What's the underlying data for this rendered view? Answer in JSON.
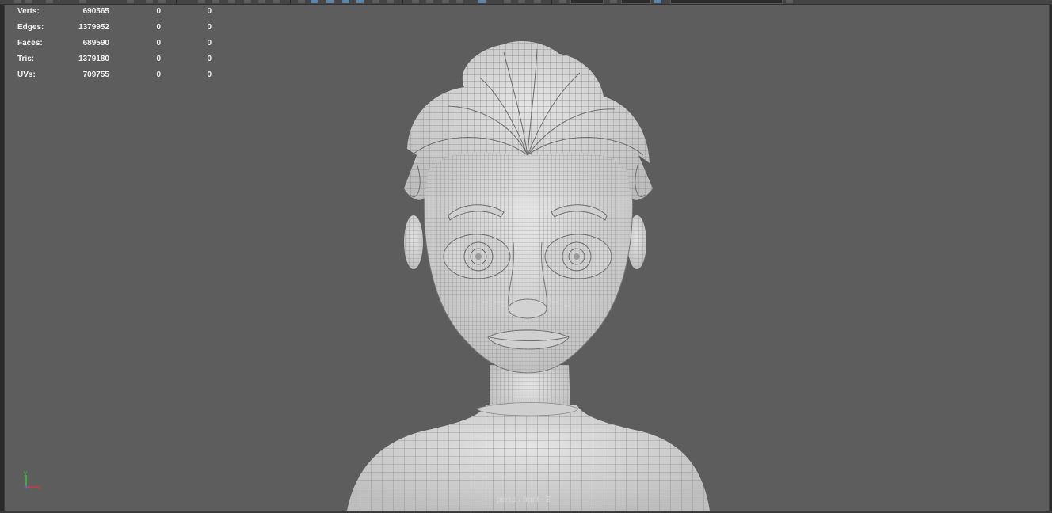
{
  "hud": {
    "rows": [
      {
        "label": "Verts:",
        "total": "690565",
        "selected": "0",
        "component": "0"
      },
      {
        "label": "Edges:",
        "total": "1379952",
        "selected": "0",
        "component": "0"
      },
      {
        "label": "Faces:",
        "total": "689590",
        "selected": "0",
        "component": "0"
      },
      {
        "label": "Tris:",
        "total": "1379180",
        "selected": "0",
        "component": "0"
      },
      {
        "label": "UVs:",
        "total": "709755",
        "selected": "0",
        "component": "0"
      }
    ]
  },
  "viewport": {
    "background_color": "#5d5d5d",
    "mesh_color": "#d9d9d9",
    "wire_color": "#8a8a8a"
  },
  "axis": {
    "y_label": "y",
    "x_label": "x",
    "y_color": "#37c837",
    "x_color": "#d23c3c"
  },
  "camera_label": "persp / front - Z"
}
